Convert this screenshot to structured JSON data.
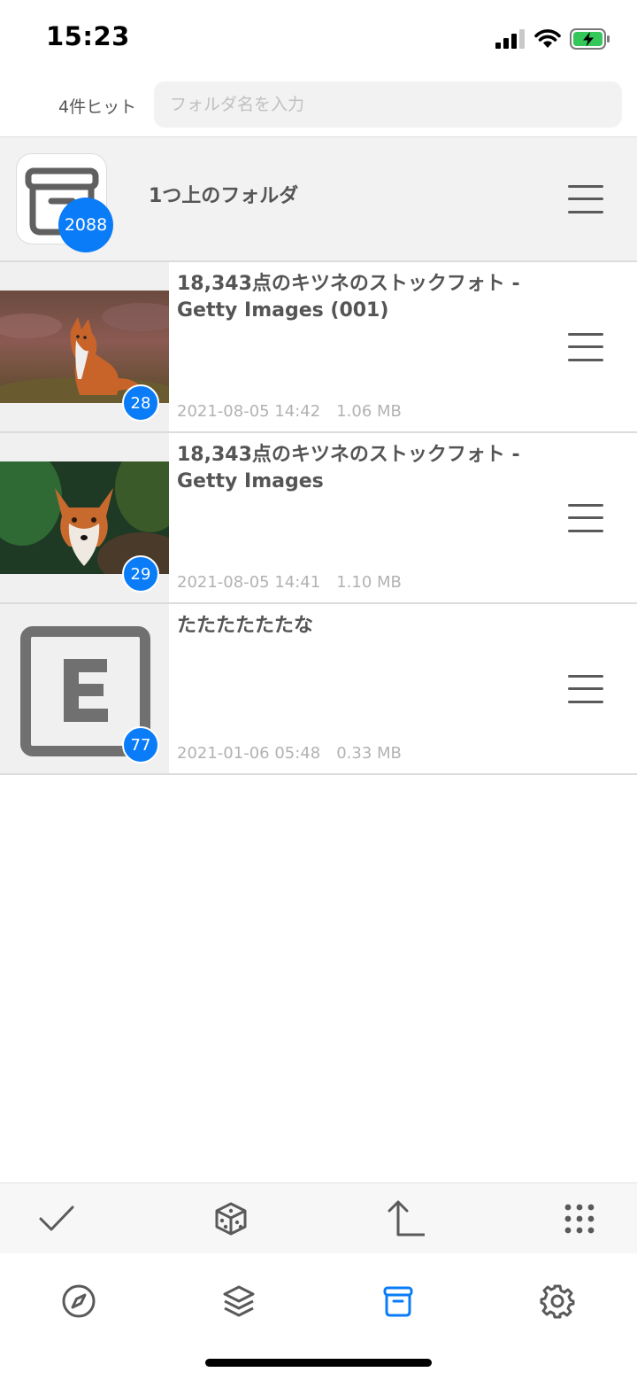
{
  "status_bar": {
    "time": "15:23"
  },
  "search": {
    "hit_count": "4件ヒット",
    "placeholder": "フォルダ名を入力",
    "value": ""
  },
  "parent_folder": {
    "label": "1つ上のフォルダ",
    "count": "2088"
  },
  "folders": [
    {
      "title": "18,343点のキツネのストックフォト - Getty Images (001)",
      "date": "2021-08-05 14:42",
      "size": "1.06 MB",
      "count": "28",
      "thumb": "fox-sitting"
    },
    {
      "title": "18,343点のキツネのストックフォト - Getty Images",
      "date": "2021-08-05 14:41",
      "size": "1.10 MB",
      "count": "29",
      "thumb": "fox-face"
    },
    {
      "title": "たたたたたたな",
      "date": "2021-01-06 05:48",
      "size": "0.33 MB",
      "count": "77",
      "thumb": "letter-e"
    }
  ],
  "toolbar": {
    "items": [
      "check-icon",
      "dice-icon",
      "up-folder-icon",
      "grid-icon"
    ]
  },
  "tabbar": {
    "items": [
      "compass-icon",
      "layers-icon",
      "archive-icon",
      "gear-icon"
    ],
    "active": "archive-icon"
  },
  "colors": {
    "accent": "#0a7cf8",
    "icon_gray": "#5a5a5a",
    "meta_gray": "#b2b2b2"
  }
}
